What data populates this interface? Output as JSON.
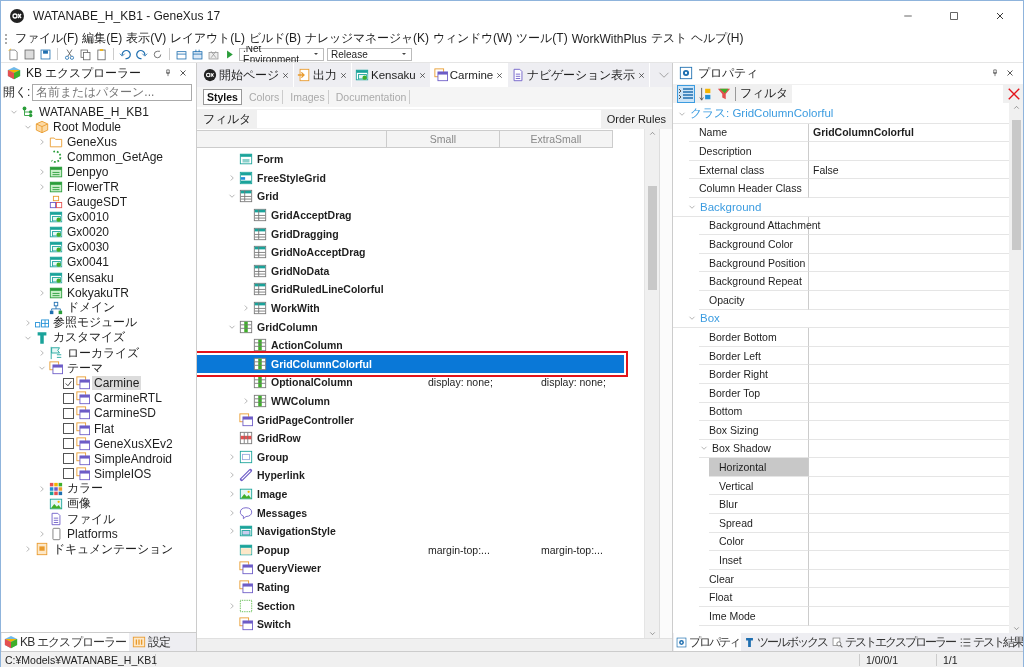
{
  "window": {
    "title": "WATANABE_H_KB1 - GeneXus 17"
  },
  "menu": [
    "ファイル(F)",
    "編集(E)",
    "表示(V)",
    "レイアウト(L)",
    "ビルド(B)",
    "ナレッジマネージャ(K)",
    "ウィンドウ(W)",
    "ツール(T)",
    "WorkWithPlus",
    "テスト",
    "ヘルプ(H)"
  ],
  "toolbar": {
    "environment": ".Net Environment",
    "configuration": "Release"
  },
  "kb_explorer": {
    "title": "KB エクスプローラー",
    "open_label": "開く:",
    "search": {
      "placeholder": "名前またはパターン..."
    },
    "tree": [
      {
        "label": "WATANABE_H_KB1",
        "kind": "kb",
        "expanded": true,
        "selected": false,
        "children": [
          {
            "label": "Root Module",
            "kind": "module",
            "expanded": true,
            "selected": false,
            "children": [
              {
                "label": "GeneXus",
                "kind": "folder",
                "expanded": false,
                "selected": false
              },
              {
                "label": "Common_GetAge",
                "kind": "procedure",
                "selected": false
              },
              {
                "label": "Denpyo",
                "kind": "transaction",
                "expanded": false,
                "selected": false
              },
              {
                "label": "FlowerTR",
                "kind": "transaction",
                "expanded": false,
                "selected": false
              },
              {
                "label": "GaugeSDT",
                "kind": "sdt",
                "selected": false
              },
              {
                "label": "Gx0010",
                "kind": "webpanel",
                "selected": false
              },
              {
                "label": "Gx0020",
                "kind": "webpanel",
                "selected": false
              },
              {
                "label": "Gx0030",
                "kind": "webpanel",
                "selected": false
              },
              {
                "label": "Gx0041",
                "kind": "webpanel",
                "selected": false
              },
              {
                "label": "Kensaku",
                "kind": "webpanel",
                "selected": false
              },
              {
                "label": "KokyakuTR",
                "kind": "transaction",
                "expanded": false,
                "selected": false
              },
              {
                "label": "ドメイン",
                "kind": "domain",
                "selected": false
              }
            ]
          },
          {
            "label": "参照モジュール",
            "kind": "references",
            "expanded": false,
            "selected": false
          },
          {
            "label": "カスタマイズ",
            "kind": "customize",
            "expanded": true,
            "selected": false,
            "children": [
              {
                "label": "ローカライズ",
                "kind": "localize",
                "expanded": false,
                "selected": false
              },
              {
                "label": "テーマ",
                "kind": "themes",
                "expanded": true,
                "selected": false,
                "children": [
                  {
                    "label": "Carmine",
                    "kind": "theme",
                    "checked": true,
                    "selected": true
                  },
                  {
                    "label": "CarmineRTL",
                    "kind": "theme",
                    "checked": false,
                    "selected": false
                  },
                  {
                    "label": "CarmineSD",
                    "kind": "theme",
                    "checked": false,
                    "selected": false
                  },
                  {
                    "label": "Flat",
                    "kind": "theme",
                    "checked": false,
                    "selected": false
                  },
                  {
                    "label": "GeneXusXEv2",
                    "kind": "theme",
                    "checked": false,
                    "selected": false
                  },
                  {
                    "label": "SimpleAndroid",
                    "kind": "theme",
                    "checked": false,
                    "selected": false
                  },
                  {
                    "label": "SimpleIOS",
                    "kind": "theme",
                    "checked": false,
                    "selected": false
                  }
                ]
              },
              {
                "label": "カラー",
                "kind": "colors",
                "expanded": false,
                "selected": false
              },
              {
                "label": "画像",
                "kind": "images",
                "selected": false
              },
              {
                "label": "ファイル",
                "kind": "files",
                "selected": false
              },
              {
                "label": "Platforms",
                "kind": "platforms",
                "expanded": false,
                "selected": false
              }
            ]
          },
          {
            "label": "ドキュメンテーション",
            "kind": "docs",
            "expanded": false,
            "selected": false
          }
        ]
      }
    ],
    "tabs": [
      {
        "label": "KB エクスプローラー",
        "kind": "kb",
        "selected": true
      },
      {
        "label": "設定",
        "kind": "settings",
        "selected": false
      }
    ]
  },
  "document_tabs": [
    {
      "label": "開始ページ",
      "kind": "start",
      "selected": false
    },
    {
      "label": "出力",
      "kind": "output",
      "selected": false
    },
    {
      "label": "Kensaku",
      "kind": "webpanel",
      "selected": false
    },
    {
      "label": "Carmine",
      "kind": "theme",
      "selected": true
    },
    {
      "label": "ナビゲーション表示",
      "kind": "navigation",
      "selected": false
    }
  ],
  "styles_editor": {
    "tabs": [
      {
        "label": "Styles",
        "selected": true
      },
      {
        "label": "Colors",
        "selected": false
      },
      {
        "label": "Images",
        "selected": false
      },
      {
        "label": "Documentation",
        "selected": false
      }
    ],
    "filter_label": "フィルタ",
    "order_rules": "Order Rules",
    "columns": [
      "Small",
      "ExtraSmall"
    ],
    "rows": [
      {
        "label": "Form",
        "kind": "form",
        "selected": false
      },
      {
        "label": "FreeStyleGrid",
        "kind": "freestyle",
        "expanded": false,
        "selected": false
      },
      {
        "label": "Grid",
        "kind": "grid",
        "expanded": true,
        "selected": false,
        "children": [
          {
            "label": "GridAcceptDrag",
            "kind": "grid",
            "selected": false
          },
          {
            "label": "GridDragging",
            "kind": "grid",
            "selected": false
          },
          {
            "label": "GridNoAcceptDrag",
            "kind": "grid",
            "selected": false
          },
          {
            "label": "GridNoData",
            "kind": "grid",
            "selected": false
          },
          {
            "label": "GridRuledLineColorful",
            "kind": "grid",
            "selected": false
          },
          {
            "label": "WorkWith",
            "kind": "grid",
            "expanded": false,
            "selected": false
          }
        ]
      },
      {
        "label": "GridColumn",
        "kind": "column",
        "expanded": true,
        "selected": false,
        "children": [
          {
            "label": "ActionColumn",
            "kind": "column",
            "selected": false
          },
          {
            "label": "GridColumnColorful",
            "kind": "column",
            "selected": true
          },
          {
            "label": "OptionalColumn",
            "kind": "column",
            "selected": false,
            "cells": [
              "display: none;",
              "display: none;"
            ]
          },
          {
            "label": "WWColumn",
            "kind": "column",
            "expanded": false,
            "selected": false
          }
        ]
      },
      {
        "label": "GridPageController",
        "kind": "class",
        "selected": false
      },
      {
        "label": "GridRow",
        "kind": "gridrow",
        "selected": false
      },
      {
        "label": "Group",
        "kind": "group",
        "expanded": false,
        "selected": false
      },
      {
        "label": "Hyperlink",
        "kind": "hyperlink",
        "expanded": false,
        "selected": false
      },
      {
        "label": "Image",
        "kind": "image",
        "expanded": false,
        "selected": false
      },
      {
        "label": "Messages",
        "kind": "messages",
        "expanded": false,
        "selected": false
      },
      {
        "label": "NavigationStyle",
        "kind": "navigation",
        "expanded": false,
        "selected": false
      },
      {
        "label": "Popup",
        "kind": "popup",
        "selected": false,
        "cells": [
          "margin-top:...",
          "margin-top:..."
        ]
      },
      {
        "label": "QueryViewer",
        "kind": "class",
        "selected": false
      },
      {
        "label": "Rating",
        "kind": "class",
        "selected": false
      },
      {
        "label": "Section",
        "kind": "section",
        "expanded": false,
        "selected": false
      },
      {
        "label": "Switch",
        "kind": "class",
        "selected": false
      }
    ]
  },
  "properties": {
    "title": "プロパティ",
    "filter_label": "フィルタ",
    "rows": [
      {
        "kind": "group",
        "name": "クラス: GridColumnColorful",
        "expanded": true,
        "children": [
          {
            "kind": "prop",
            "name": "Name",
            "value": "GridColumnColorful",
            "modified": true,
            "selected": false
          },
          {
            "kind": "prop",
            "name": "Description",
            "selected": false
          },
          {
            "kind": "prop",
            "name": "External class",
            "value": "False",
            "selected": false
          },
          {
            "kind": "prop",
            "name": "Column Header Class",
            "selected": false
          },
          {
            "kind": "group",
            "name": "Background",
            "expanded": true,
            "children": [
              {
                "kind": "prop",
                "name": "Background Attachment",
                "selected": false
              },
              {
                "kind": "prop",
                "name": "Background Color",
                "selected": false
              },
              {
                "kind": "prop",
                "name": "Background Position",
                "selected": false
              },
              {
                "kind": "prop",
                "name": "Background Repeat",
                "selected": false
              },
              {
                "kind": "prop",
                "name": "Opacity",
                "selected": false
              }
            ]
          },
          {
            "kind": "group",
            "name": "Box",
            "expanded": true,
            "children": [
              {
                "kind": "prop",
                "name": "Border Bottom",
                "selected": false
              },
              {
                "kind": "prop",
                "name": "Border Left",
                "selected": false
              },
              {
                "kind": "prop",
                "name": "Border Right",
                "selected": false
              },
              {
                "kind": "prop",
                "name": "Border Top",
                "selected": false
              },
              {
                "kind": "prop",
                "name": "Bottom",
                "selected": false
              },
              {
                "kind": "prop",
                "name": "Box Sizing",
                "selected": false
              },
              {
                "kind": "compound",
                "name": "Box Shadow",
                "expanded": true,
                "selected": false,
                "children": [
                  {
                    "kind": "prop",
                    "name": "Horizontal",
                    "selected": true
                  },
                  {
                    "kind": "prop",
                    "name": "Vertical",
                    "selected": false
                  },
                  {
                    "kind": "prop",
                    "name": "Blur",
                    "selected": false
                  },
                  {
                    "kind": "prop",
                    "name": "Spread",
                    "selected": false
                  },
                  {
                    "kind": "prop",
                    "name": "Color",
                    "selected": false
                  },
                  {
                    "kind": "prop",
                    "name": "Inset",
                    "selected": false
                  }
                ]
              },
              {
                "kind": "prop",
                "name": "Clear",
                "selected": false
              },
              {
                "kind": "prop",
                "name": "Float",
                "selected": false
              },
              {
                "kind": "prop",
                "name": "Ime Mode",
                "selected": false
              }
            ]
          }
        ]
      }
    ],
    "tabs": [
      {
        "label": "プロパティ",
        "kind": "properties",
        "selected": true
      },
      {
        "label": "ツールボックス",
        "kind": "toolbox",
        "selected": false
      },
      {
        "label": "テストエクスプローラー",
        "kind": "test-explorer",
        "selected": false
      },
      {
        "label": "テスト結果",
        "kind": "test-results",
        "selected": false
      }
    ]
  },
  "status_bar": {
    "path": "C:¥Models¥WATANABE_H_KB1",
    "counts": "1/0/0/1",
    "position": "1/1"
  }
}
